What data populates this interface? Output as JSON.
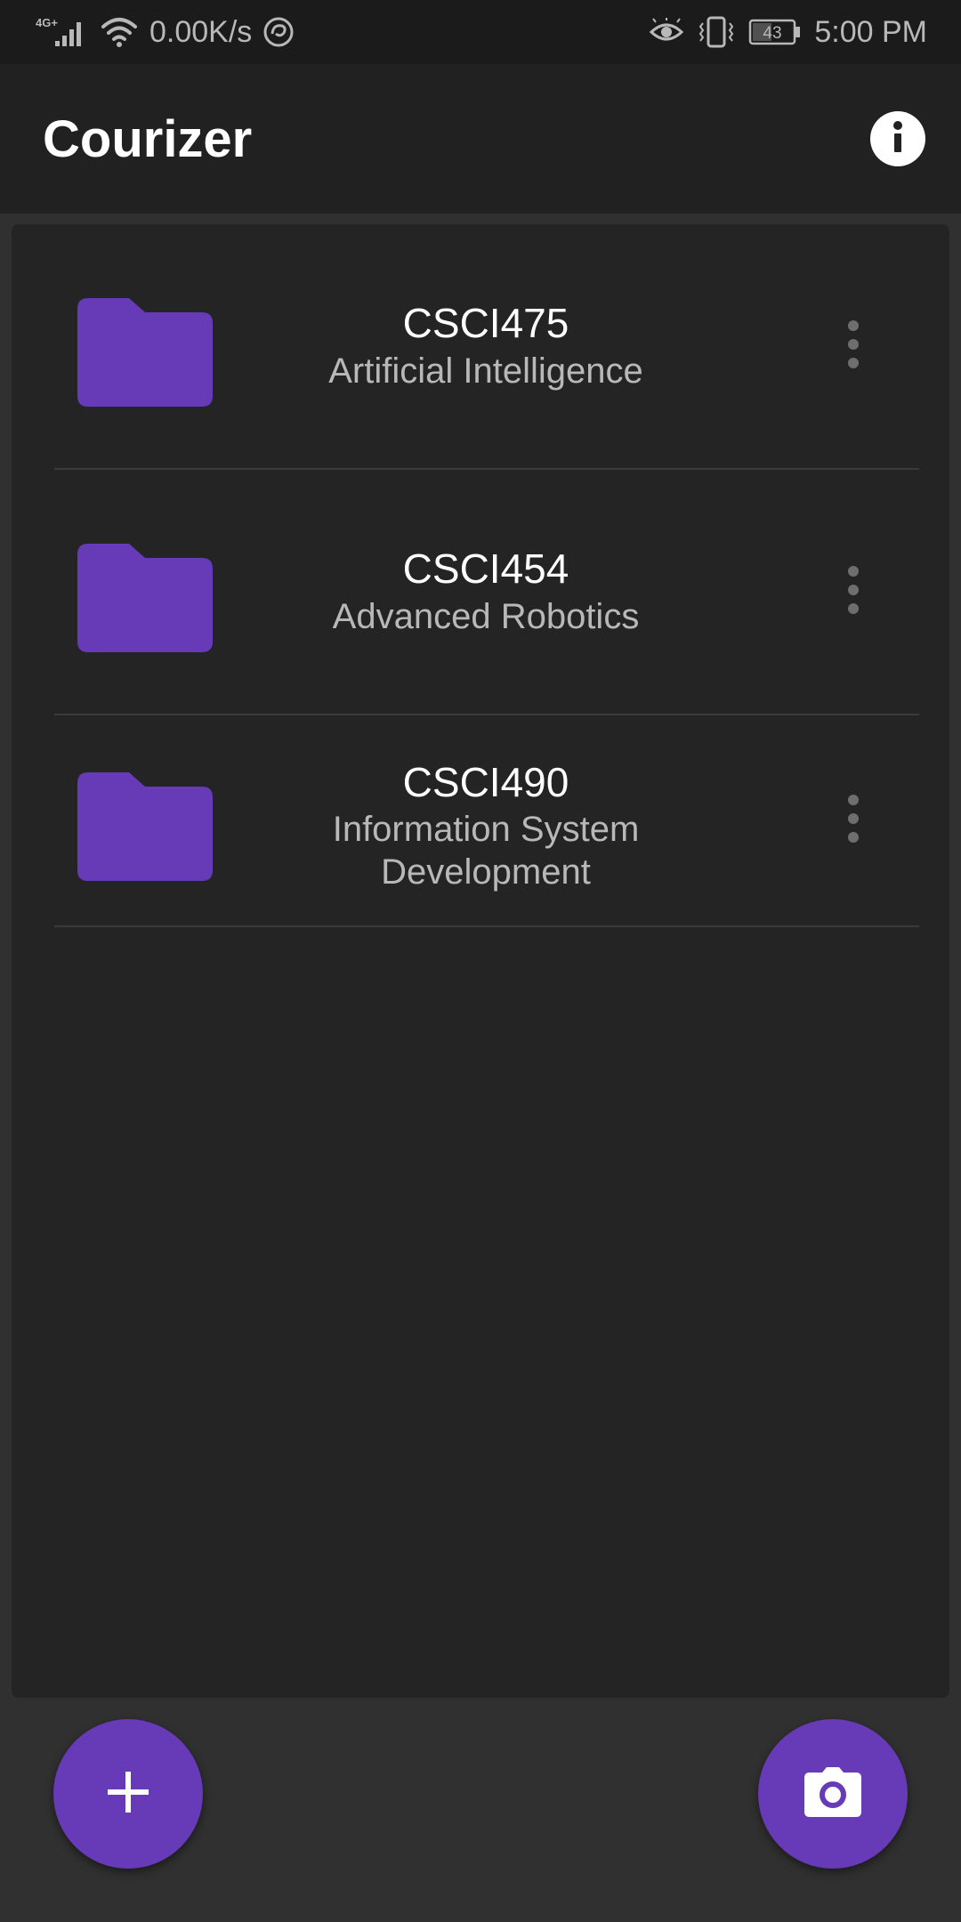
{
  "status_bar": {
    "network_type": "4G+",
    "speed": "0.00K/s",
    "battery": "43",
    "time": "5:00 PM",
    "icons": [
      "signal-icon",
      "wifi-icon",
      "app-notification-icon",
      "eye-comfort-icon",
      "vibrate-icon",
      "battery-icon"
    ]
  },
  "app_bar": {
    "title": "Courizer",
    "info_icon": "info-icon"
  },
  "courses": [
    {
      "code": "CSCI475",
      "name": "Artificial Intelligence"
    },
    {
      "code": "CSCI454",
      "name": "Advanced Robotics"
    },
    {
      "code": "CSCI490",
      "name": "Information System Development"
    }
  ],
  "fabs": {
    "add_icon": "plus-icon",
    "camera_icon": "camera-icon"
  },
  "colors": {
    "accent": "#673ab7",
    "folder": "#673ab7",
    "background": "#303030",
    "surface": "#242424",
    "app_bar": "#212121",
    "status_bar": "#1b1b1b"
  }
}
